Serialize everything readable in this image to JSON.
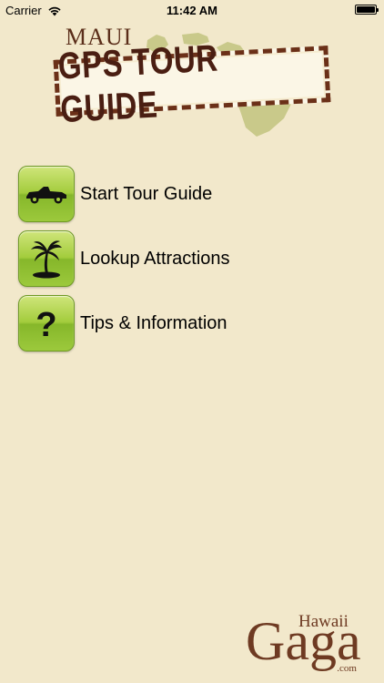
{
  "status_bar": {
    "carrier": "Carrier",
    "time": "11:42 AM",
    "battery_level": 1.0,
    "wifi_icon": "wifi-icon",
    "battery_icon": "battery-icon"
  },
  "header": {
    "subtitle": "MAUI",
    "title": "GPS TOUR GUIDE",
    "map_icon": "hawaii-islands-map"
  },
  "menu": {
    "items": [
      {
        "label": "Start Tour Guide",
        "icon": "car-icon"
      },
      {
        "label": "Lookup Attractions",
        "icon": "palm-tree-icon"
      },
      {
        "label": "Tips & Information",
        "icon": "question-mark-icon"
      }
    ],
    "question_glyph": "?"
  },
  "brand": {
    "hawaii": "Hawaii",
    "gaga": "Gaga",
    "com": ".com"
  },
  "colors": {
    "background": "#f2e8cb",
    "accent_green": "#a3cc3c",
    "brand_brown": "#6e3a22",
    "title_brown": "#4a1e12",
    "map_green": "#c9c98a"
  }
}
